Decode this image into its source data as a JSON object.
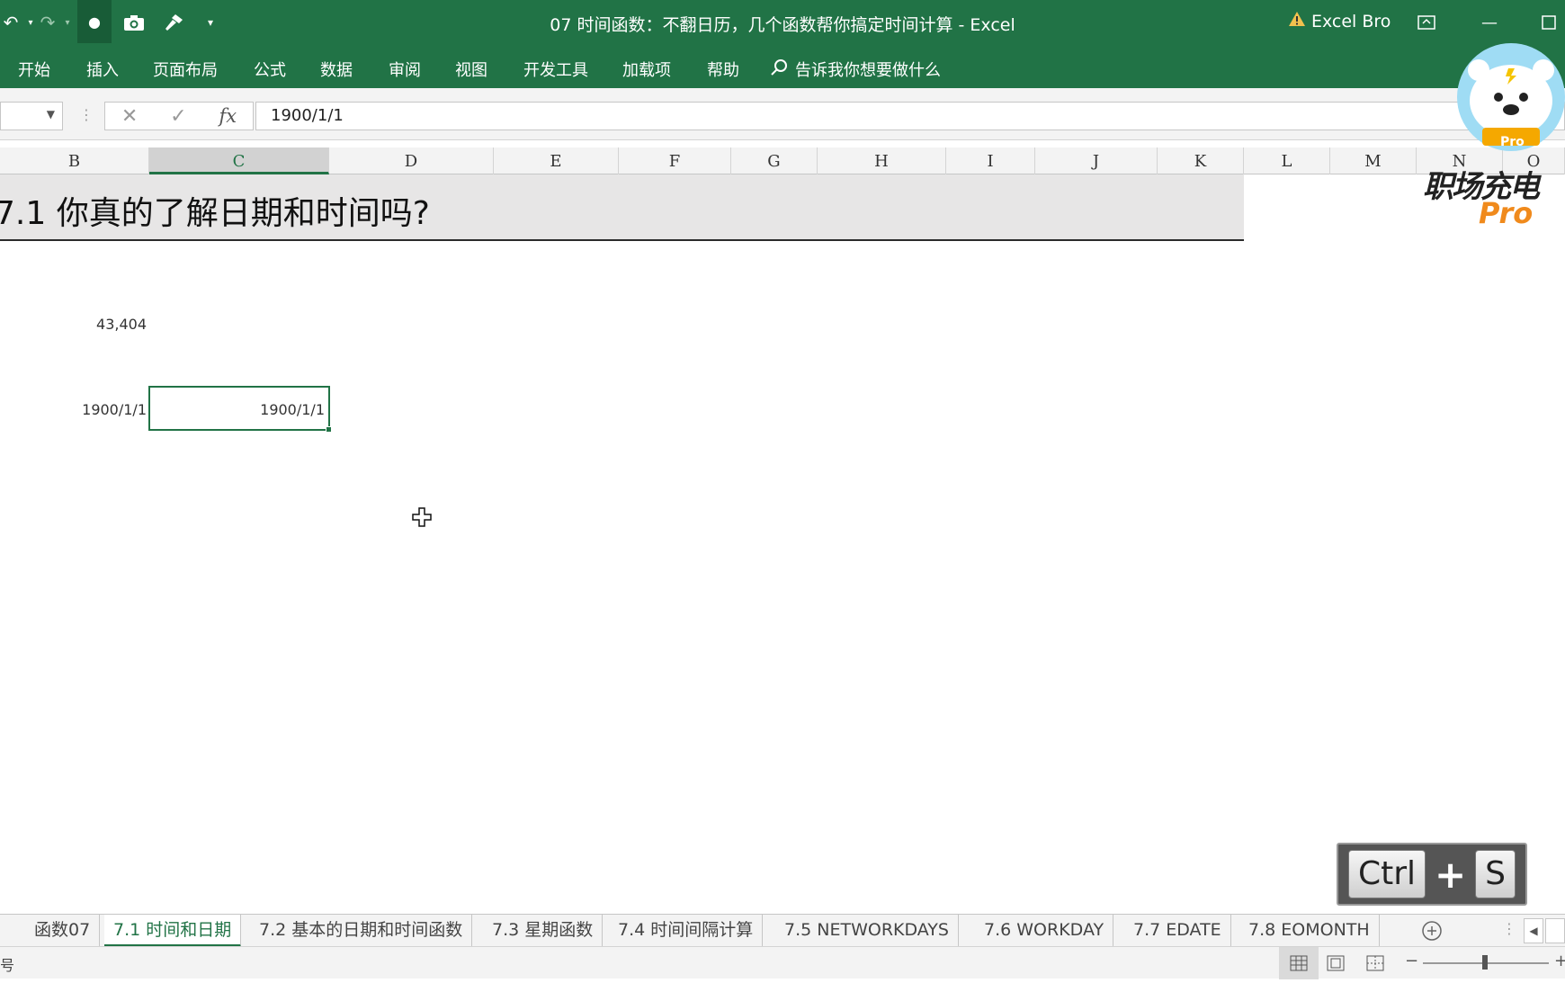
{
  "titlebar": {
    "title": "07 时间函数：不翻日历，几个函数帮你搞定时间计算  -  Excel",
    "warning_user": "Excel Bro",
    "accent": "#217346"
  },
  "ribbon": {
    "tabs": [
      "开始",
      "插入",
      "页面布局",
      "公式",
      "数据",
      "审阅",
      "视图",
      "开发工具",
      "加载项",
      "帮助"
    ],
    "tell_me": "告诉我你想要做什么"
  },
  "formula_bar": {
    "value": "1900/1/1"
  },
  "columns": [
    "B",
    "C",
    "D",
    "E",
    "F",
    "G",
    "H",
    "I",
    "J",
    "K",
    "L",
    "M",
    "N",
    "O"
  ],
  "sheet": {
    "heading": "7.1 你真的了解日期和时间吗?",
    "b_number": "43,404",
    "b_date": "1900/1/1",
    "c_date": "1900/1/1"
  },
  "sheet_tabs": [
    "函数07",
    "7.1 时间和日期",
    "7.2 基本的日期和时间函数",
    "7.3 星期函数",
    "7.4 时间间隔计算",
    "7.5 NETWORKDAYS",
    "7.6 WORKDAY",
    "7.7 EDATE",
    "7.8 EOMONTH"
  ],
  "status": {
    "left_text": "号"
  },
  "overlay": {
    "key1": "Ctrl",
    "plus": "+",
    "key2": "S",
    "brand_line1": "职场充电",
    "brand_line2": "Pro",
    "badge": "Pro"
  }
}
